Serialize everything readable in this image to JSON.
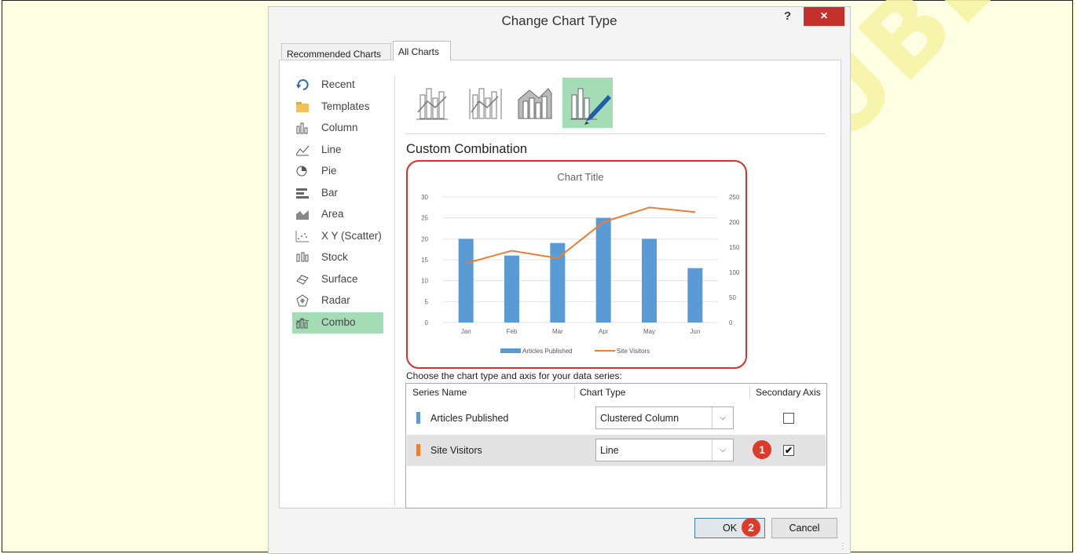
{
  "dialog": {
    "title": "Change Chart Type",
    "help_label": "?",
    "close_label": "×"
  },
  "tabs": [
    {
      "label": "Recommended Charts"
    },
    {
      "label": "All Charts"
    }
  ],
  "chart_types": [
    {
      "label": "Recent",
      "icon": "recent-icon"
    },
    {
      "label": "Templates",
      "icon": "templates-folder-icon"
    },
    {
      "label": "Column",
      "icon": "column-chart-icon"
    },
    {
      "label": "Line",
      "icon": "line-chart-icon"
    },
    {
      "label": "Pie",
      "icon": "pie-chart-icon"
    },
    {
      "label": "Bar",
      "icon": "bar-chart-icon"
    },
    {
      "label": "Area",
      "icon": "area-chart-icon"
    },
    {
      "label": "X Y (Scatter)",
      "icon": "scatter-chart-icon"
    },
    {
      "label": "Stock",
      "icon": "stock-chart-icon"
    },
    {
      "label": "Surface",
      "icon": "surface-chart-icon"
    },
    {
      "label": "Radar",
      "icon": "radar-chart-icon"
    },
    {
      "label": "Combo",
      "icon": "combo-chart-icon",
      "selected": true
    }
  ],
  "combo_subtypes": [
    {
      "icon": "clustered-column-line-icon"
    },
    {
      "icon": "clustered-column-line-secondary-axis-icon"
    },
    {
      "icon": "stacked-area-clustered-column-icon"
    },
    {
      "icon": "custom-combination-icon",
      "selected": true
    }
  ],
  "section_title": "Custom Combination",
  "chart_data": {
    "type": "bar",
    "title": "Chart Title",
    "categories": [
      "Jan",
      "Feb",
      "Mar",
      "Apr",
      "May",
      "Jun"
    ],
    "series": [
      {
        "name": "Articles Published",
        "type": "bar",
        "axis": "primary",
        "color": "#5b9bd5",
        "values": [
          20,
          16,
          19,
          25,
          20,
          13
        ]
      },
      {
        "name": "Site Visitors",
        "type": "line",
        "axis": "secondary",
        "color": "#ed7d31",
        "values": [
          118,
          143,
          128,
          200,
          229,
          220
        ]
      }
    ],
    "ylim": [
      0,
      30
    ],
    "y_ticks": [
      "0",
      "5",
      "10",
      "15",
      "20",
      "25",
      "30"
    ],
    "y2lim": [
      0,
      250
    ],
    "y2_ticks": [
      "0",
      "50",
      "100",
      "150",
      "200",
      "250"
    ],
    "grid": true,
    "legend": "bottom"
  },
  "series_section": {
    "prompt": "Choose the chart type and axis for your data series:",
    "headers": {
      "name": "Series Name",
      "type": "Chart Type",
      "axis": "Secondary Axis"
    },
    "rows": [
      {
        "name": "Articles Published",
        "color": "#5b9bd5",
        "chart_type": "Clustered Column",
        "secondary_axis": false
      },
      {
        "name": "Site Visitors",
        "color": "#ed7d31",
        "chart_type": "Line",
        "secondary_axis": true
      }
    ]
  },
  "annotations": {
    "step1": "1",
    "step2": "2"
  },
  "buttons": {
    "ok": "OK",
    "cancel": "Cancel"
  },
  "watermark": "UNPUBLISHED"
}
